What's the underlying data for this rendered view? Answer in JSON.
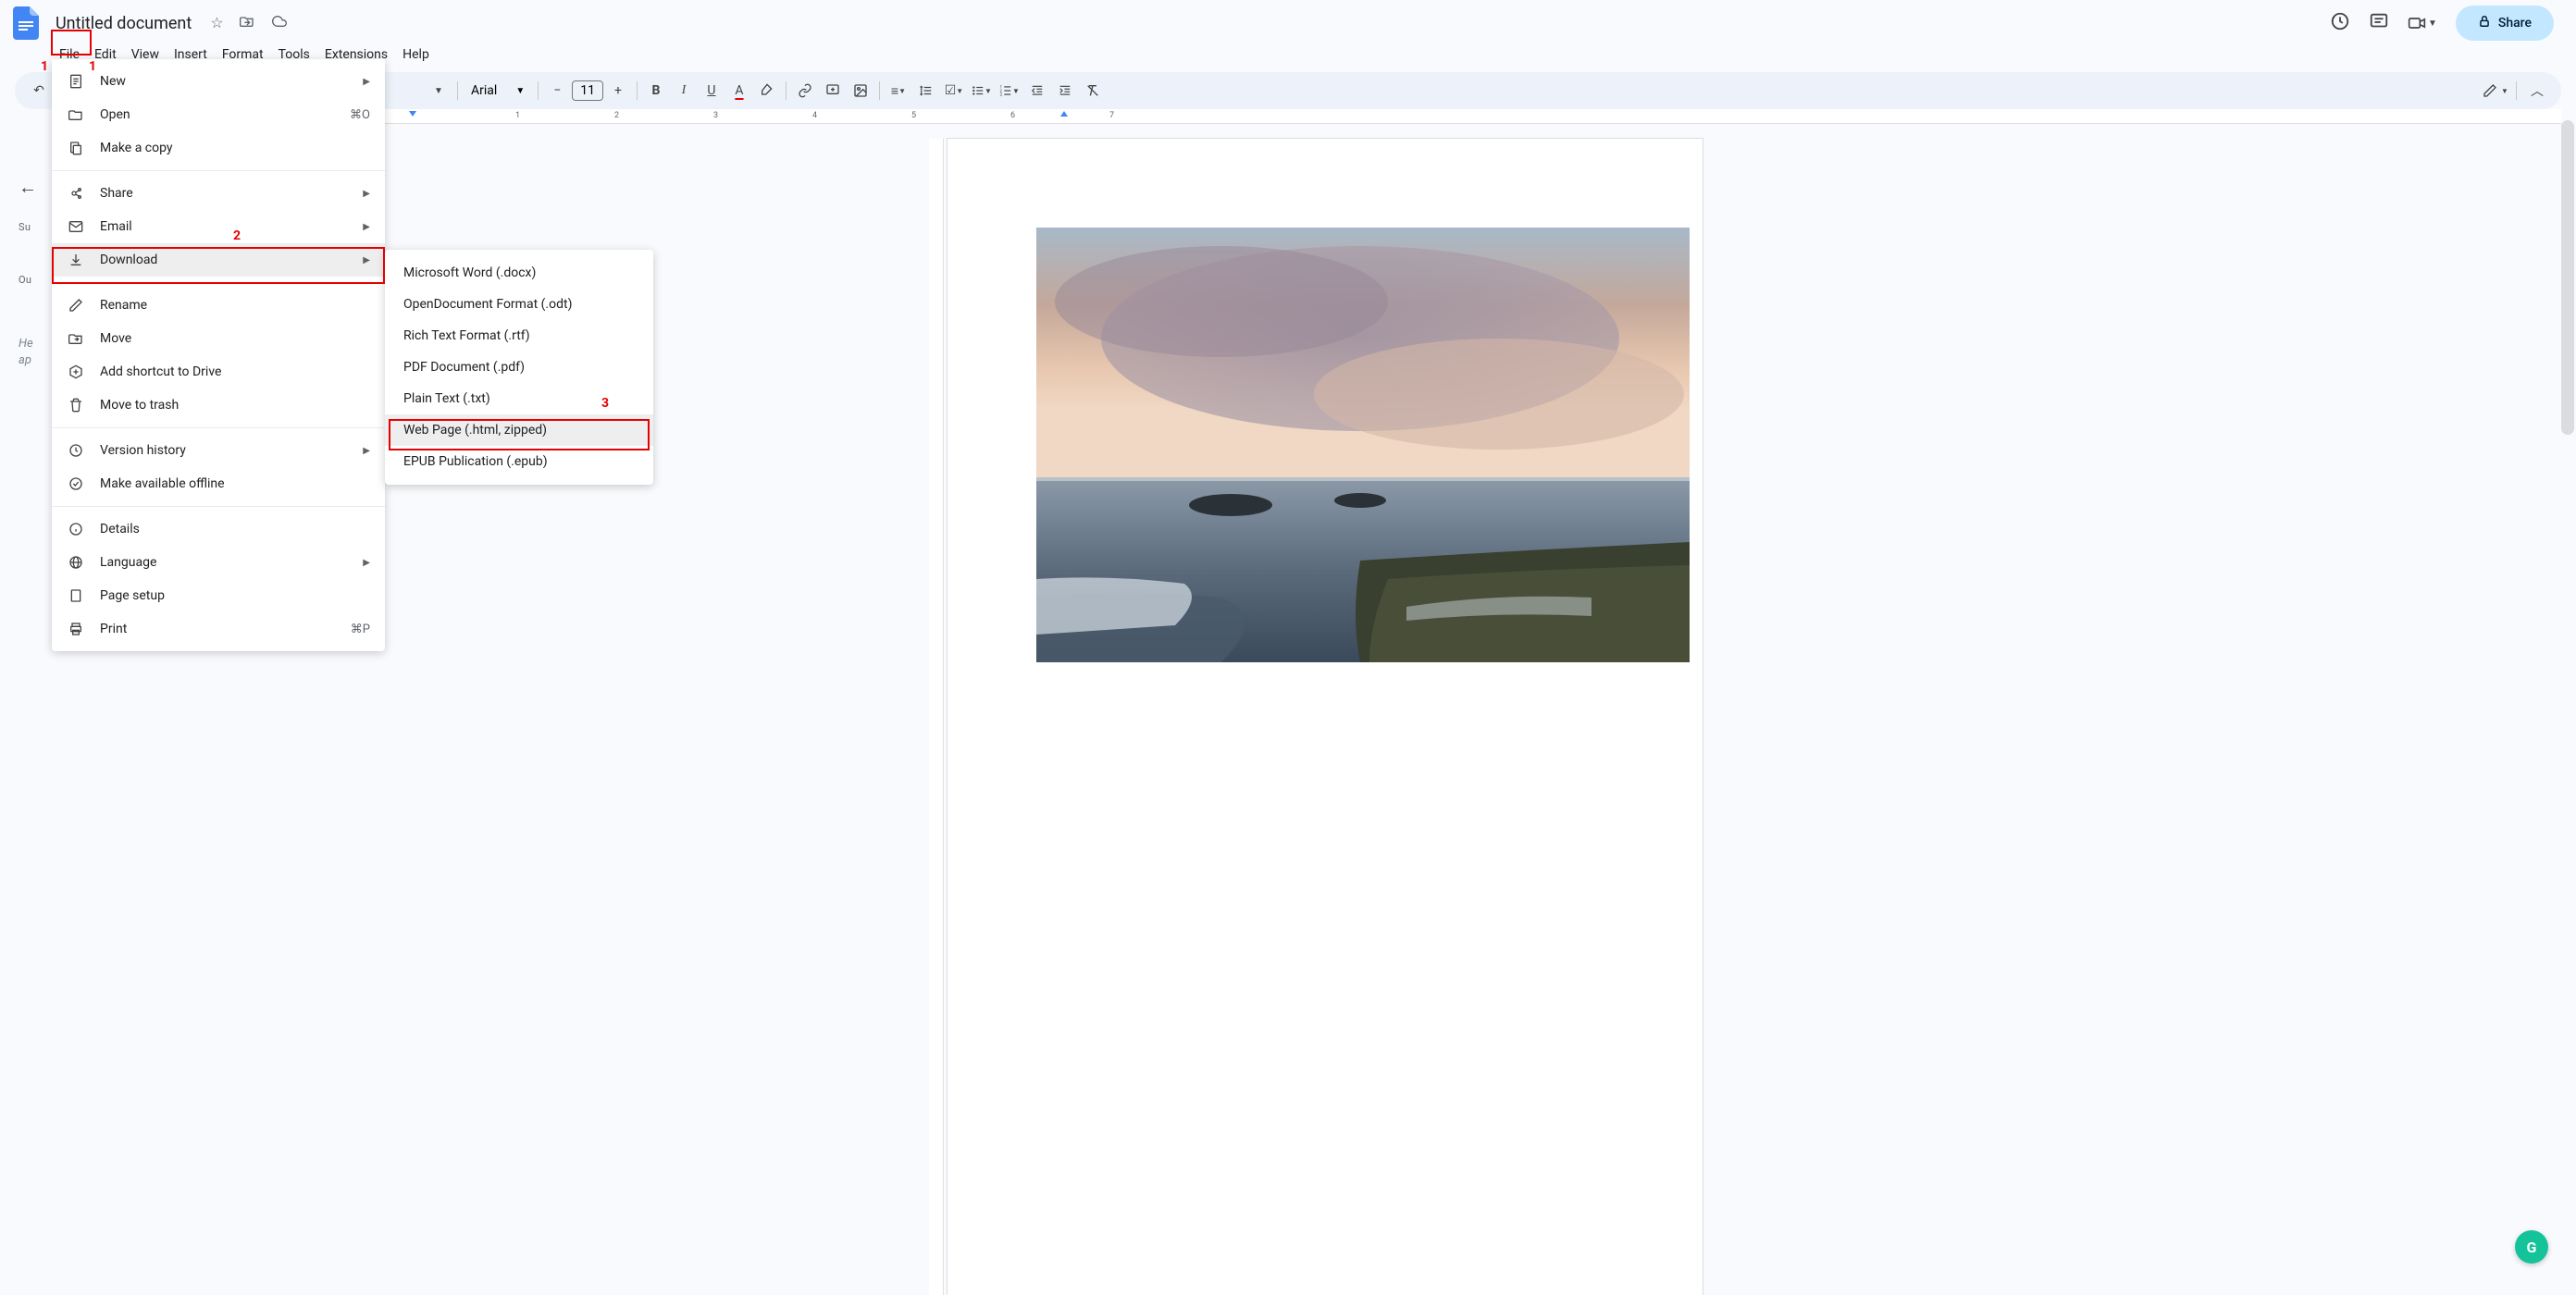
{
  "document": {
    "title": "Untitled document"
  },
  "menubar": [
    "File",
    "Edit",
    "View",
    "Insert",
    "Format",
    "Tools",
    "Extensions",
    "Help"
  ],
  "header": {
    "share": "Share"
  },
  "toolbar": {
    "font": "Arial",
    "font_size": "11"
  },
  "file_menu": {
    "items": [
      {
        "label": "New",
        "icon": "doc",
        "arrow": true
      },
      {
        "label": "Open",
        "icon": "folder",
        "shortcut": "⌘O"
      },
      {
        "label": "Make a copy",
        "icon": "copy"
      },
      {
        "divider": true
      },
      {
        "label": "Share",
        "icon": "share",
        "arrow": true
      },
      {
        "label": "Email",
        "icon": "mail",
        "arrow": true
      },
      {
        "label": "Download",
        "icon": "download",
        "arrow": true,
        "highlighted": true
      },
      {
        "divider": true
      },
      {
        "label": "Rename",
        "icon": "rename"
      },
      {
        "label": "Move",
        "icon": "move"
      },
      {
        "label": "Add shortcut to Drive",
        "icon": "shortcut"
      },
      {
        "label": "Move to trash",
        "icon": "trash"
      },
      {
        "divider": true
      },
      {
        "label": "Version history",
        "icon": "history",
        "arrow": true
      },
      {
        "label": "Make available offline",
        "icon": "offline"
      },
      {
        "divider": true
      },
      {
        "label": "Details",
        "icon": "info"
      },
      {
        "label": "Language",
        "icon": "globe",
        "arrow": true
      },
      {
        "label": "Page setup",
        "icon": "page"
      },
      {
        "label": "Print",
        "icon": "print",
        "shortcut": "⌘P"
      }
    ]
  },
  "download_submenu": [
    {
      "label": "Microsoft Word (.docx)"
    },
    {
      "label": "OpenDocument Format (.odt)"
    },
    {
      "label": "Rich Text Format (.rtf)"
    },
    {
      "label": "PDF Document (.pdf)"
    },
    {
      "label": "Plain Text (.txt)"
    },
    {
      "label": "Web Page (.html, zipped)",
      "highlighted": true
    },
    {
      "label": "EPUB Publication (.epub)"
    }
  ],
  "sidebar": {
    "summary_label": "Su",
    "outline_label": "Ou",
    "placeholder1": "He",
    "placeholder2": "ap"
  },
  "ruler_marks": [
    "1",
    "2",
    "3",
    "4",
    "5",
    "6",
    "7"
  ],
  "annotations": {
    "n1": "1",
    "n1b": "1",
    "n2": "2",
    "n3": "3"
  }
}
